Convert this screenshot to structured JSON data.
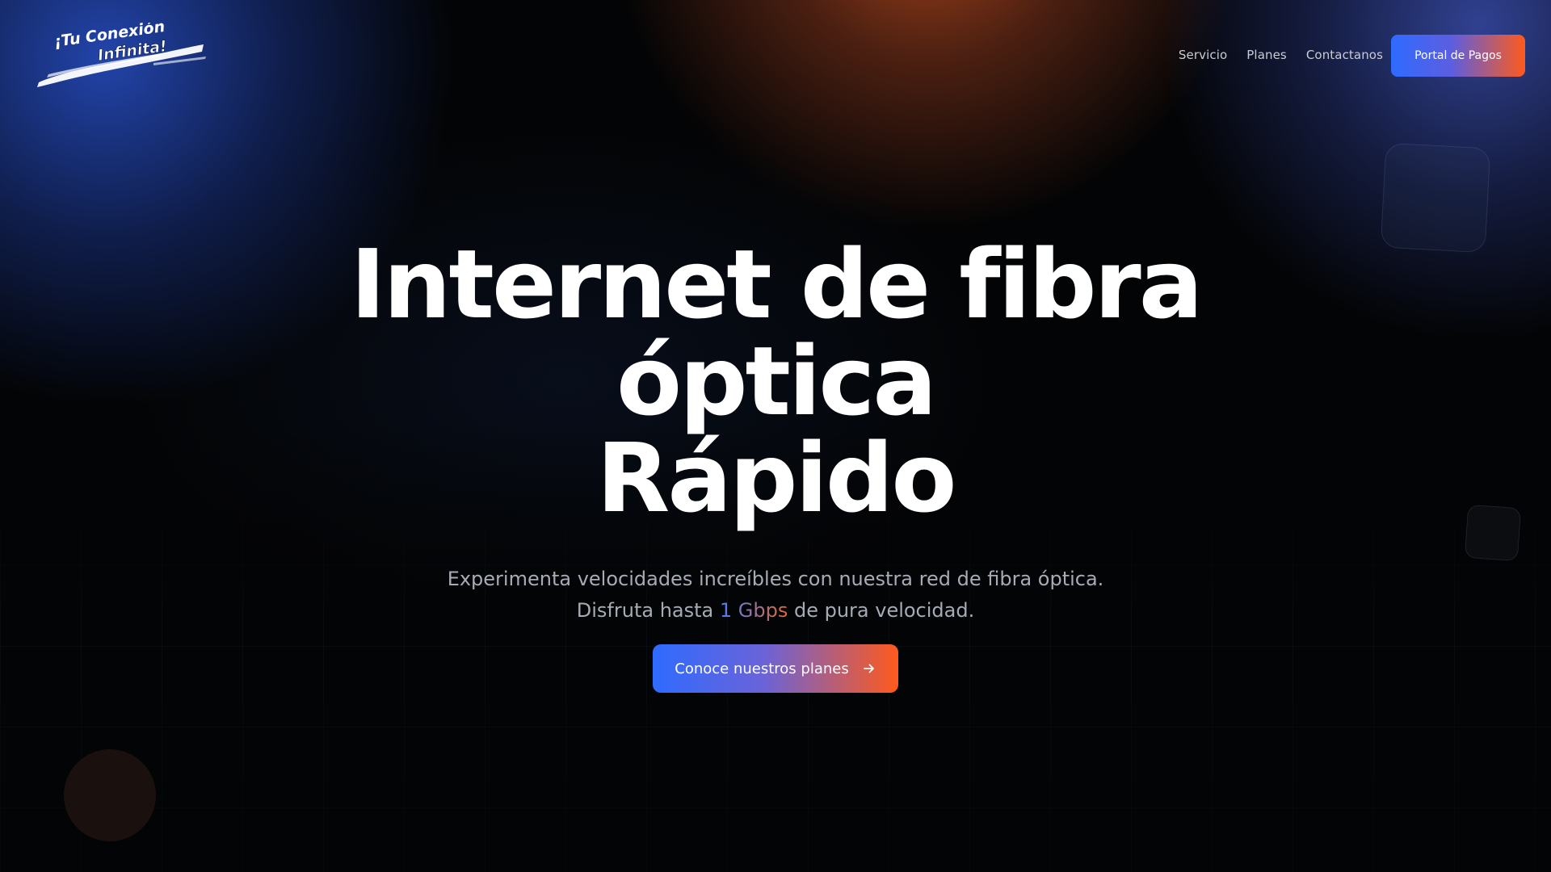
{
  "header": {
    "logo_text_line1": "¡Tu Conexión",
    "logo_text_line2": "Infinita!",
    "nav": [
      {
        "label": "Servicio"
      },
      {
        "label": "Planes"
      },
      {
        "label": "Contactanos"
      }
    ],
    "portal_button_label": "Portal de Pagos"
  },
  "hero": {
    "title_lines": [
      "Internet de fibra",
      "óptica",
      "Rápido"
    ],
    "subtitle_line1": "Experimenta velocidades increíbles con nuestra red de fibra óptica.",
    "subtitle_line2_prefix": "Disfruta hasta ",
    "subtitle_speed": "1 Gbps",
    "subtitle_line2_suffix": " de pura velocidad.",
    "cta_label": "Conoce nuestros planes",
    "cta_icon": "arrow-right-icon"
  },
  "colors": {
    "accent_blue": "#2f6bff",
    "accent_orange": "#ff5a1c",
    "background": "#030405",
    "text_primary": "#ffffff",
    "text_muted": "#a6abb6"
  }
}
